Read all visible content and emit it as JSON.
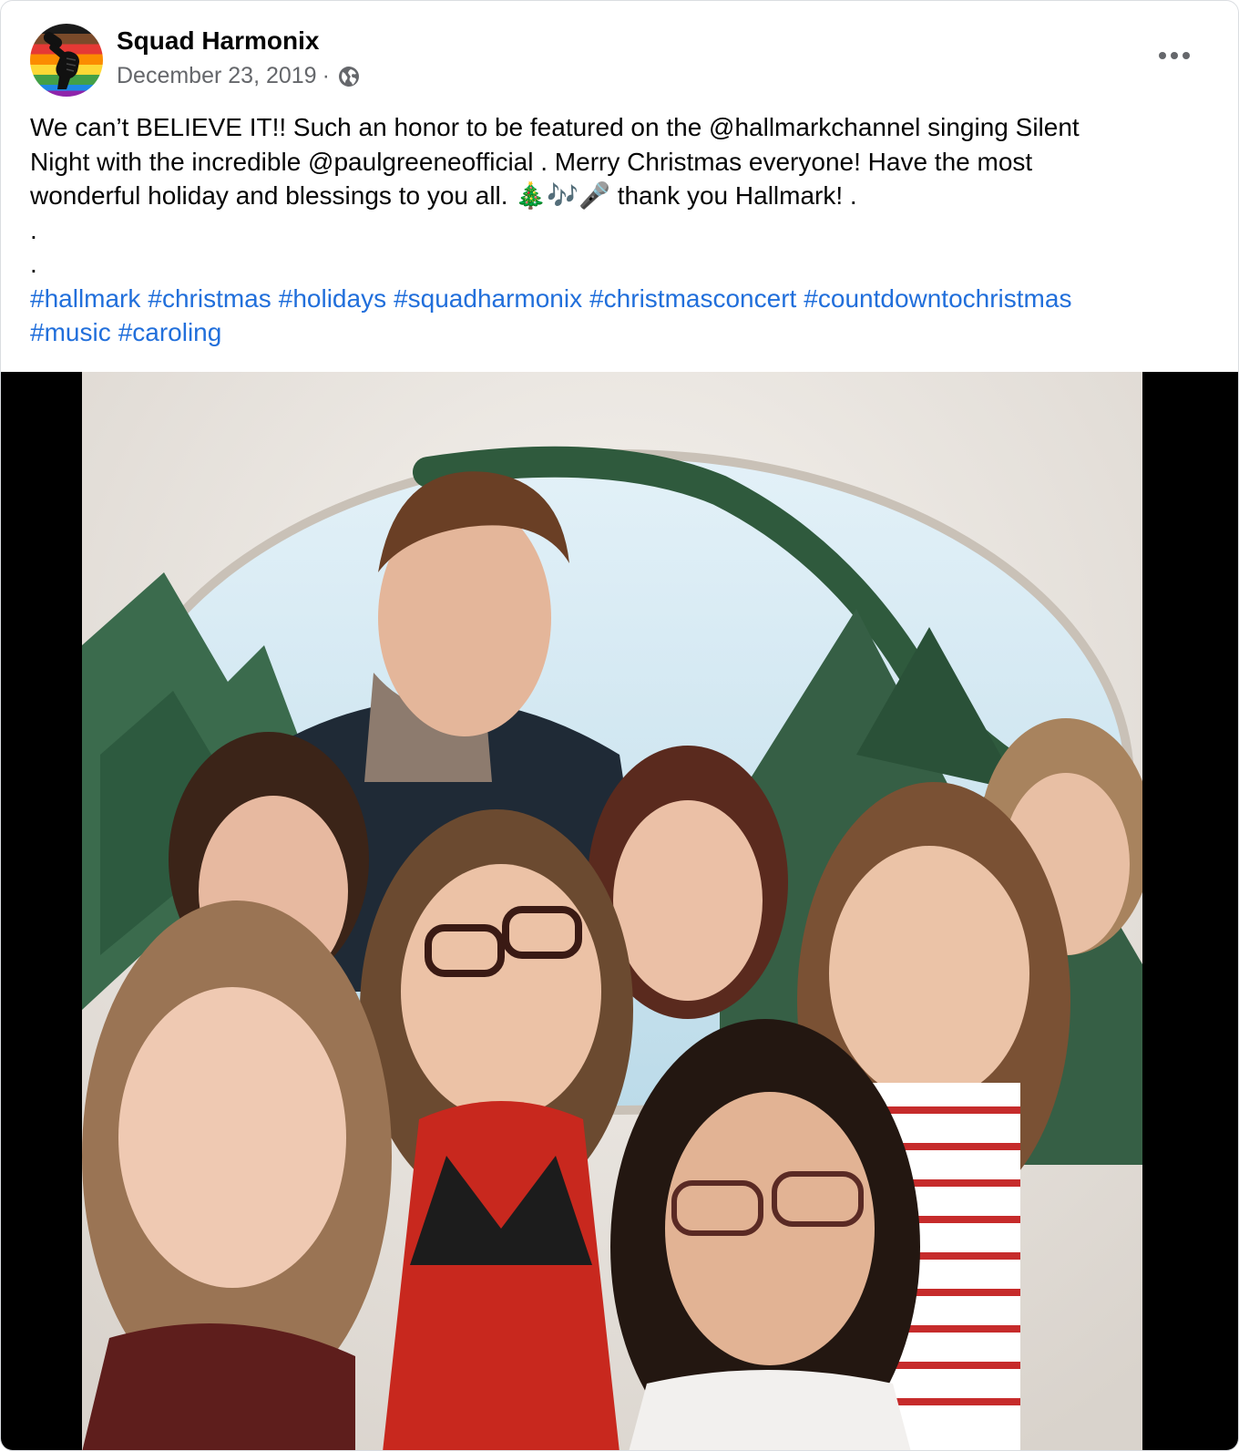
{
  "post": {
    "author": "Squad Harmonix",
    "date": "December 23, 2019",
    "separator": "·",
    "privacy_icon": "globe-icon",
    "more_icon": "ellipsis-icon",
    "caption_lines": [
      "We can’t BELIEVE IT!! Such an honor to be featured on the @hallmarkchannel singing Silent",
      "Night with the incredible @paulgreeneofficial . Merry Christmas everyone! Have the most",
      "wonderful holiday and blessings to you all. 🎄🎶🎤 thank you Hallmark! .",
      ".",
      "."
    ],
    "hashtags_line1": [
      "#hallmark",
      "#christmas",
      "#holidays",
      "#squadharmonix",
      "#christmasconcert",
      "#countdowntochristmas"
    ],
    "hashtags_line2": [
      "#music",
      "#caroling"
    ]
  },
  "colors": {
    "link": "#216fdb",
    "meta_text": "#65676b",
    "video_letterbox": "#000000"
  }
}
